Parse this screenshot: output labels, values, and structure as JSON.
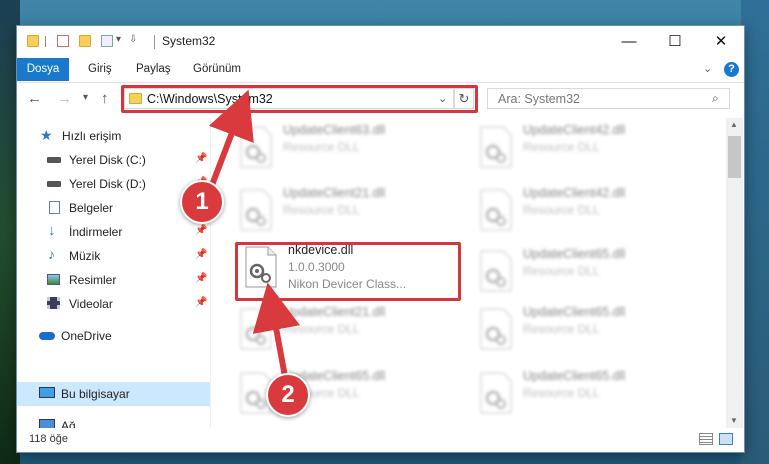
{
  "window": {
    "title": "System32"
  },
  "controls": {
    "minimize": "—",
    "maximize": "☐",
    "close": "✕"
  },
  "ribbon": {
    "tabs": [
      "Dosya",
      "Giriş",
      "Paylaş",
      "Görünüm"
    ]
  },
  "address": {
    "path": "C:\\Windows\\System32",
    "refresh_glyph": "↻"
  },
  "search": {
    "placeholder": "Ara: System32"
  },
  "sidebar": {
    "items": [
      {
        "label": "Hızlı erişim",
        "icon": "star-icon",
        "pinned": false
      },
      {
        "label": "Yerel Disk (C:)",
        "icon": "drive-icon",
        "pinned": true
      },
      {
        "label": "Yerel Disk (D:)",
        "icon": "drive-icon",
        "pinned": true
      },
      {
        "label": "Belgeler",
        "icon": "documents-icon",
        "pinned": true
      },
      {
        "label": "İndirmeler",
        "icon": "download-icon",
        "pinned": true
      },
      {
        "label": "Müzik",
        "icon": "music-icon",
        "pinned": true
      },
      {
        "label": "Resimler",
        "icon": "pictures-icon",
        "pinned": true
      },
      {
        "label": "Videolar",
        "icon": "videos-icon",
        "pinned": true
      },
      {
        "label": "OneDrive",
        "icon": "cloud-icon",
        "pinned": false
      },
      {
        "label": "Bu bilgisayar",
        "icon": "computer-icon",
        "pinned": false,
        "selected": true
      },
      {
        "label": "Ağ",
        "icon": "network-icon",
        "pinned": false
      }
    ]
  },
  "files": {
    "left": [
      {
        "name": "UpdateClient63.dll",
        "type": "Resource DLL"
      },
      {
        "name": "UpdateClient21.dll",
        "type": "Resource DLL"
      },
      {
        "name": "nkdevice.dll",
        "version": "1.0.0.3000",
        "description": "Nikon Devicer Class..."
      },
      {
        "name": "UpdateClient21.dll",
        "type": "Resource DLL"
      },
      {
        "name": "UpdateClient65.dll",
        "type": "Resource DLL"
      }
    ],
    "right": [
      {
        "name": "UpdateClient42.dll",
        "type": "Resource DLL"
      },
      {
        "name": "UpdateClient42.dll",
        "type": "Resource DLL"
      },
      {
        "name": "UpdateClient65.dll",
        "type": "Resource DLL"
      },
      {
        "name": "UpdateClient65.dll",
        "type": "Resource DLL"
      },
      {
        "name": "UpdateClient65.dll",
        "type": "Resource DLL"
      }
    ]
  },
  "status": {
    "item_count": "118 öğe"
  },
  "callouts": [
    "1",
    "2"
  ],
  "colors": {
    "accent": "#1979ca",
    "highlight": "#d6363a",
    "callout": "#d93a3e"
  }
}
